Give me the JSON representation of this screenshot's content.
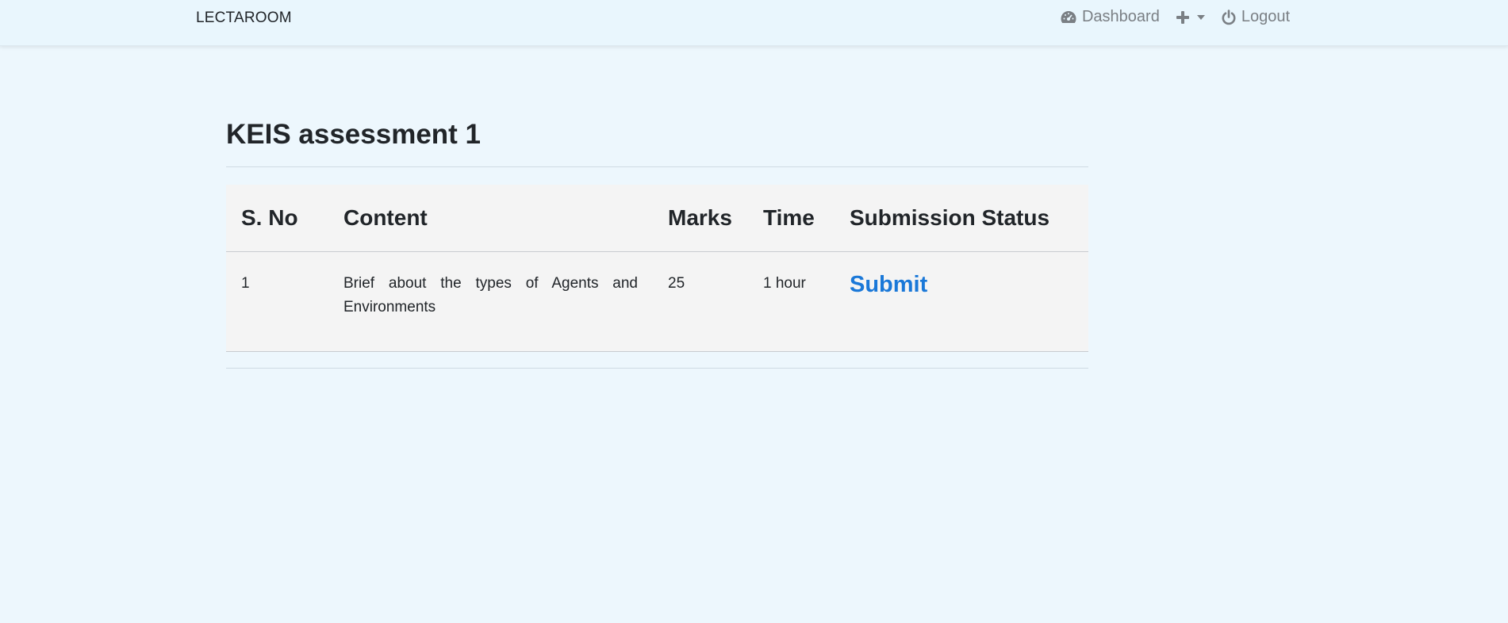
{
  "navbar": {
    "brand": "LECTAROOM",
    "dashboard_label": "Dashboard",
    "logout_label": "Logout",
    "icons": {
      "dashboard": "speedometer-icon",
      "add": "plus-icon",
      "logout": "power-icon"
    }
  },
  "page": {
    "title": "KEIS assessment 1"
  },
  "table": {
    "headers": [
      "S. No",
      "Content",
      "Marks",
      "Time",
      "Submission Status"
    ],
    "rows": [
      {
        "sno": "1",
        "content": "Brief about the types of Agents and Environments",
        "marks": "25",
        "time": "1 hour",
        "status": "Submit"
      }
    ]
  },
  "colors": {
    "background": "#edf7fd",
    "link": "#1a78d8",
    "table_bg": "#f4f4f4"
  }
}
